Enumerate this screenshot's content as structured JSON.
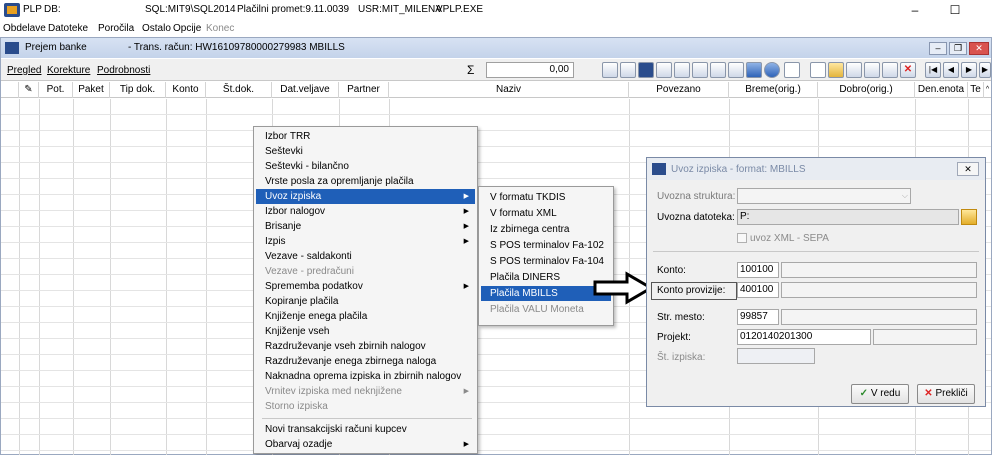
{
  "titlebar": {
    "app": "PLP",
    "db_label": "DB:",
    "server": "SQL:MIT9\\SQL2014",
    "promet": "Plačilni promet:9.11.0039",
    "user": "USR:MIT_MILENA",
    "exe": "VPLP.EXE",
    "minimize": "–",
    "maximize": "☐",
    "close": "✕"
  },
  "menubar": [
    "Obdelave",
    "Datoteke",
    "Poročila",
    "Ostalo",
    "Opcije",
    "Konec"
  ],
  "inner": {
    "title": "Prejem banke",
    "subtitle": "- Trans. račun: HW16109780000279983  MBILLS",
    "tabs": [
      "Pregled",
      "Korekture",
      "Podrobnosti"
    ],
    "sum_symbol": "Σ",
    "sum_value": "0,00"
  },
  "grid": {
    "columns": [
      "Pot.",
      "Paket",
      "Tip dok.",
      "Konto",
      "Št.dok.",
      "Dat.veljave",
      "Partner",
      "Naziv",
      "Povezano",
      "Breme(orig.)",
      "Dobro(orig.)",
      "Den.enota",
      "Te"
    ]
  },
  "context_menu": {
    "items": [
      {
        "label": "Izbor TRR"
      },
      {
        "label": "Seštevki"
      },
      {
        "label": "Seštevki - bilančno"
      },
      {
        "label": "Vrste posla za opremljanje plačila"
      },
      {
        "label": "Uvoz izpiska",
        "arrow": "▶"
      },
      {
        "label": "Izbor nalogov",
        "arrow": "▶"
      },
      {
        "label": "Brisanje",
        "arrow": "▶"
      },
      {
        "label": "Izpis",
        "arrow": "▶"
      },
      {
        "label": "Vezave - saldakonti"
      },
      {
        "label": "Vezave - predračuni"
      },
      {
        "label": "Sprememba podatkov",
        "arrow": "▶"
      },
      {
        "label": "Kopiranje plačila"
      },
      {
        "label": "Knjiženje enega plačila"
      },
      {
        "label": "Knjiženje vseh"
      },
      {
        "label": "Razdruževanje vseh zbirnih nalogov"
      },
      {
        "label": "Razdruževanje enega zbirnega naloga"
      },
      {
        "label": "Naknadna oprema izpiska in zbirnih nalogov"
      },
      {
        "label": "Vrnitev izpiska med neknjižene",
        "arrow": "▶"
      },
      {
        "label": "Storno izpiska"
      },
      {
        "label": "Novi transakcijski računi kupcev"
      },
      {
        "label": "Obarvaj ozadje",
        "arrow": "▶"
      }
    ]
  },
  "submenu": {
    "items": [
      {
        "label": "V formatu TKDIS"
      },
      {
        "label": "V formatu XML"
      },
      {
        "label": "Iz zbirnega centra"
      },
      {
        "label": "S POS terminalov Fa-102"
      },
      {
        "label": "S POS terminalov Fa-104"
      },
      {
        "label": "Plačila DINERS"
      },
      {
        "label": "Plačila MBILLS"
      },
      {
        "label": "Plačila VALU Moneta"
      }
    ]
  },
  "dialog": {
    "title": "Uvoz izpiska - format: MBILLS",
    "close": "✕",
    "uvozna_struktura_label": "Uvozna struktura:",
    "uvozna_datoteka_label": "Uvozna datoteka:",
    "uvozna_datoteka_value": "P:",
    "xml_sepa_label": "uvoz XML - SEPA",
    "konto_label": "Konto:",
    "konto_value": "100100",
    "konto_provizije_label": "Konto provizije:",
    "konto_provizije_value": "400100",
    "str_mesto_label": "Str. mesto:",
    "str_mesto_value": "99857",
    "projekt_label": "Projekt:",
    "projekt_value": "0120140201300",
    "st_izpiska_label": "Št. izpiska:",
    "ok_label": "V redu",
    "cancel_label": "Prekliči"
  }
}
